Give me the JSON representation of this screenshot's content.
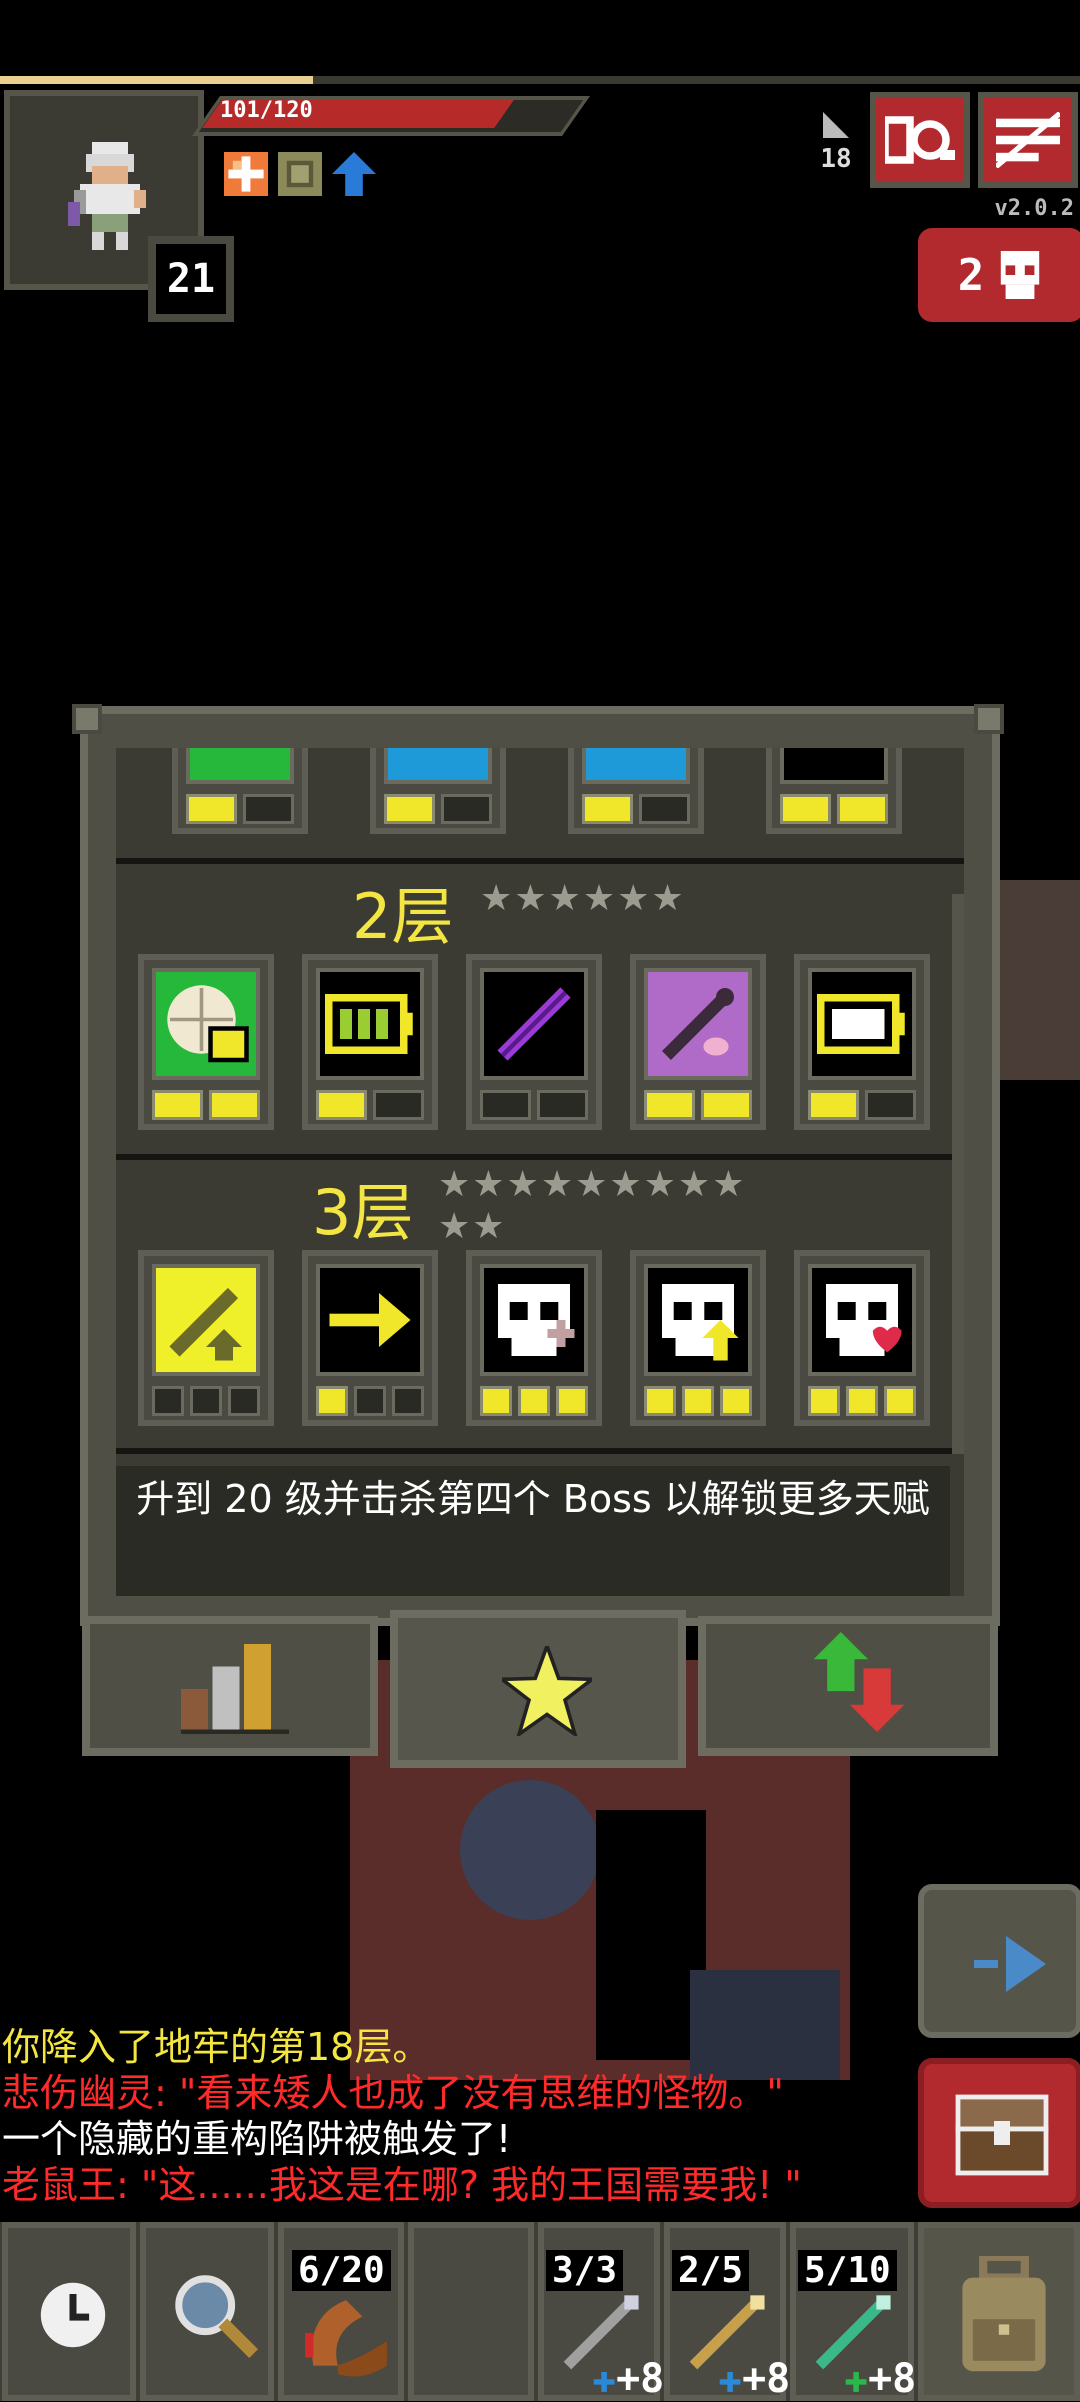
{
  "status": {
    "hp_text": "101/120",
    "hp_fraction": 0.84,
    "xp_fraction": 0.29,
    "level": "21",
    "depth": "18",
    "version": "v2.0.2",
    "danger_count": "2",
    "buff_icons": [
      "frost-buff-icon",
      "armor-buff-icon",
      "haste-buff-icon"
    ]
  },
  "talents": {
    "tiers": [
      {
        "label": "",
        "stars": "",
        "talents": [
          {
            "icon": "partial-talent-1-icon",
            "points": 1,
            "max": 2
          },
          {
            "icon": "partial-talent-2-icon",
            "points": 1,
            "max": 2
          },
          {
            "icon": "partial-talent-3-icon",
            "points": 1,
            "max": 2
          },
          {
            "icon": "partial-talent-4-icon",
            "points": 2,
            "max": 2
          }
        ]
      },
      {
        "label": "2层",
        "stars": "★★★★★★",
        "talents": [
          {
            "icon": "ration-talent-icon",
            "points": 2,
            "max": 2
          },
          {
            "icon": "battery-full-talent-icon",
            "points": 1,
            "max": 2
          },
          {
            "icon": "purple-wand-talent-icon",
            "points": 0,
            "max": 2
          },
          {
            "icon": "wand-charm-talent-icon",
            "points": 2,
            "max": 2
          },
          {
            "icon": "battery-empty-talent-icon",
            "points": 1,
            "max": 2
          }
        ]
      },
      {
        "label": "3层",
        "stars": "★★★★★★★★★",
        "stars2": "★★",
        "talents": [
          {
            "icon": "wand-upgrade-talent-icon",
            "points": 0,
            "max": 3
          },
          {
            "icon": "arrow-right-talent-icon",
            "points": 1,
            "max": 3
          },
          {
            "icon": "skull-plus-talent-icon",
            "points": 3,
            "max": 3
          },
          {
            "icon": "skull-arrow-talent-icon",
            "points": 3,
            "max": 3
          },
          {
            "icon": "skull-heart-talent-icon",
            "points": 3,
            "max": 3
          }
        ]
      }
    ],
    "hint": "升到 20 级并击杀第四个 Boss 以解锁更多天赋",
    "tabs": [
      "stats-tab-icon",
      "talents-tab-icon",
      "upgrades-tab-icon"
    ]
  },
  "log": [
    {
      "text": "你降入了地牢的第18层。",
      "color": "#f4e642"
    },
    {
      "text": "悲伤幽灵: \"看来矮人也成了没有思维的怪物。\"",
      "color": "#ff2a2a"
    },
    {
      "text": "一个隐藏的重构陷阱被触发了!",
      "color": "#ffffff"
    },
    {
      "text": "老鼠王: \"这......我这是在哪? 我的王国需要我! \"",
      "color": "#ff2a2a"
    }
  ],
  "toolbar": {
    "quickslots": [
      {
        "count": "6/20",
        "bonus": "",
        "icon": "boomerang-icon"
      },
      {
        "count": "",
        "bonus": "",
        "icon": "empty-slot"
      },
      {
        "count": "3/3",
        "bonus": "+8",
        "icon": "wand-lightning-icon"
      },
      {
        "count": "2/5",
        "bonus": "+8",
        "icon": "wand-gold-icon"
      },
      {
        "count": "5/10",
        "bonus": "+8",
        "icon": "wand-green-icon"
      }
    ]
  },
  "colors": {
    "accent_red": "#b32a2e",
    "talent_yellow": "#f4e642",
    "panel": "#3b3b34"
  }
}
